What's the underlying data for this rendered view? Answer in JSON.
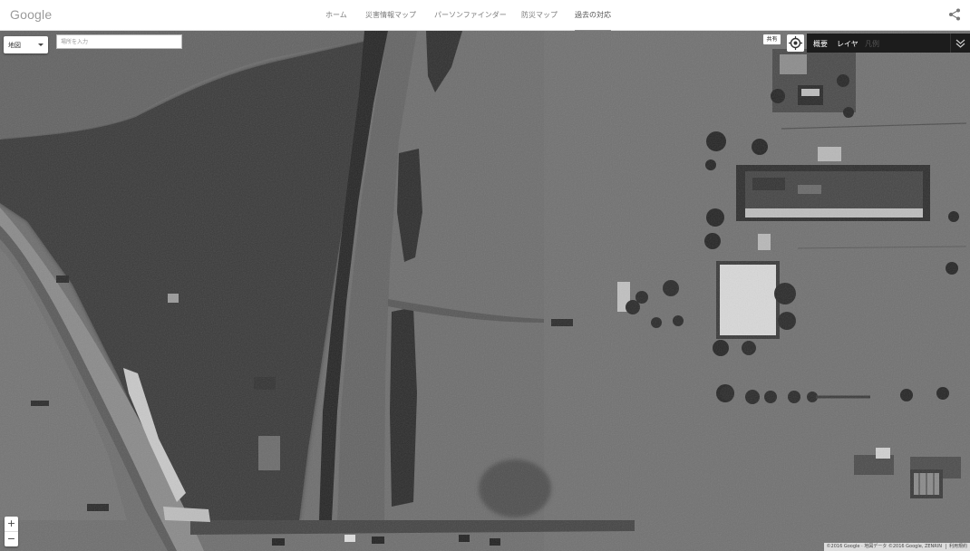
{
  "header": {
    "logo": "Google",
    "nav": [
      {
        "label": "ホーム",
        "active": false
      },
      {
        "label": "災害情報マップ",
        "active": false
      },
      {
        "label": "パーソンファインダー",
        "active": false
      },
      {
        "label": "防災マップ",
        "active": false
      },
      {
        "label": "過去の対応",
        "active": true
      }
    ],
    "share_icon": "share-icon"
  },
  "map": {
    "type_selector": "地図",
    "search_placeholder": "場所を入力",
    "share_label": "共有",
    "locate_icon": "locate-icon",
    "layers": {
      "overview": "概要",
      "layer": "レイヤ",
      "legend": "凡例",
      "expand_icon": "chevron-double-down-icon"
    },
    "zoom_in": "+",
    "zoom_out": "−",
    "attribution": {
      "data": "©2016 Google · 地図データ ©2016 Google, ZENRIN",
      "terms": "利用規約"
    }
  }
}
